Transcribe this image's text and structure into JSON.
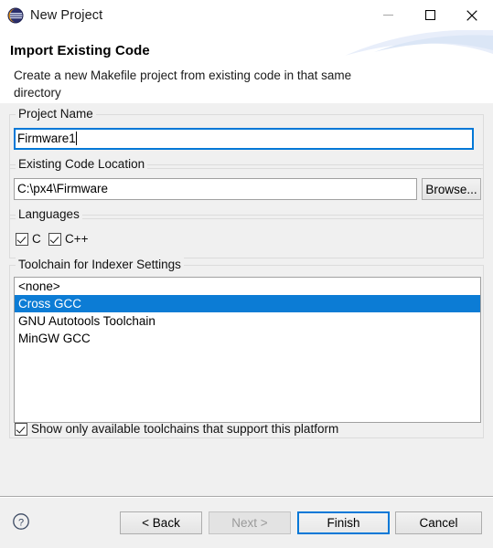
{
  "window": {
    "title": "New Project",
    "icon": "eclipse-logo-icon",
    "controls": {
      "minimize": {
        "label": "Minimize",
        "icon": "minimize-icon",
        "enabled": false
      },
      "maximize": {
        "label": "Maximize",
        "icon": "maximize-icon",
        "enabled": true
      },
      "close": {
        "label": "Close",
        "icon": "close-icon",
        "enabled": true
      }
    }
  },
  "header": {
    "title": "Import Existing Code",
    "description": "Create a new Makefile project from existing code in that same directory"
  },
  "form": {
    "project_name": {
      "group_label": "Project Name",
      "value": "Firmware1",
      "placeholder": "",
      "focused": true
    },
    "existing_code_location": {
      "group_label": "Existing Code Location",
      "value": "C:\\px4\\Firmware",
      "placeholder": "",
      "browse_label": "Browse..."
    },
    "languages": {
      "group_label": "Languages",
      "options": [
        {
          "label": "C",
          "checked": true
        },
        {
          "label": "C++",
          "checked": true
        }
      ]
    },
    "toolchain": {
      "group_label": "Toolchain for Indexer Settings",
      "items": [
        {
          "label": "<none>",
          "selected": false
        },
        {
          "label": "Cross GCC",
          "selected": true
        },
        {
          "label": "GNU Autotools Toolchain",
          "selected": false
        },
        {
          "label": "MinGW GCC",
          "selected": false
        }
      ],
      "show_available_only": {
        "label": "Show only available toolchains that support this platform",
        "checked": true
      }
    }
  },
  "buttonbar": {
    "help_label": "?",
    "back_label": "< Back",
    "next_label": "Next >",
    "finish_label": "Finish",
    "cancel_label": "Cancel",
    "next_enabled": false,
    "finish_is_default": true
  },
  "colors": {
    "selection_blue": "#0c7cd5",
    "focus_blue": "#0078d7",
    "dialog_background": "#f0f0f0",
    "field_background": "#ffffff",
    "banner_background": "#ffffff"
  }
}
